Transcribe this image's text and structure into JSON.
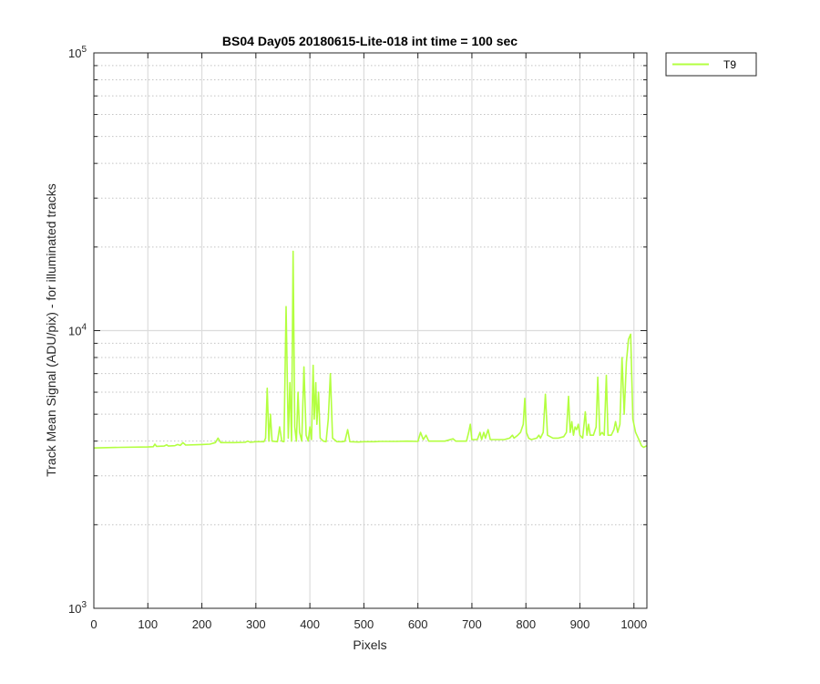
{
  "chart_data": {
    "type": "line",
    "title": "BS04 Day05 20180615-Lite-018 int time = 100 sec",
    "xlabel": "Pixels",
    "ylabel": "Track Mean Signal (ADU/pix) - for illuminated tracks",
    "xlim": [
      0,
      1024
    ],
    "ylim": [
      1000,
      100000
    ],
    "yscale": "log",
    "grid": true,
    "legend_position": "top-right outside",
    "x_ticks": [
      0,
      100,
      200,
      300,
      400,
      500,
      600,
      700,
      800,
      900,
      1000
    ],
    "x_tick_labels": [
      "0",
      "100",
      "200",
      "300",
      "400",
      "500",
      "600",
      "700",
      "800",
      "900",
      "1000"
    ],
    "y_ticks": [
      {
        "value": 1000,
        "base": "10",
        "exp": "3"
      },
      {
        "value": 10000,
        "base": "10",
        "exp": "4"
      },
      {
        "value": 100000,
        "base": "10",
        "exp": "5"
      }
    ],
    "series": [
      {
        "name": "T9",
        "color": "#b3ff40",
        "points": [
          [
            0,
            3780
          ],
          [
            50,
            3800
          ],
          [
            100,
            3810
          ],
          [
            110,
            3820
          ],
          [
            113,
            3900
          ],
          [
            116,
            3830
          ],
          [
            130,
            3840
          ],
          [
            135,
            3880
          ],
          [
            138,
            3840
          ],
          [
            150,
            3850
          ],
          [
            155,
            3890
          ],
          [
            160,
            3860
          ],
          [
            165,
            3950
          ],
          [
            170,
            3870
          ],
          [
            200,
            3890
          ],
          [
            215,
            3900
          ],
          [
            225,
            3950
          ],
          [
            230,
            4100
          ],
          [
            235,
            3950
          ],
          [
            260,
            3950
          ],
          [
            280,
            3960
          ],
          [
            285,
            4000
          ],
          [
            290,
            3960
          ],
          [
            300,
            3980
          ],
          [
            315,
            3980
          ],
          [
            318,
            4100
          ],
          [
            321,
            6200
          ],
          [
            324,
            4000
          ],
          [
            327,
            5000
          ],
          [
            330,
            4000
          ],
          [
            340,
            3980
          ],
          [
            344,
            4500
          ],
          [
            348,
            4000
          ],
          [
            352,
            3980
          ],
          [
            356,
            12200
          ],
          [
            360,
            4100
          ],
          [
            363,
            6500
          ],
          [
            366,
            4000
          ],
          [
            369,
            19300
          ],
          [
            372,
            4500
          ],
          [
            375,
            4000
          ],
          [
            378,
            6000
          ],
          [
            381,
            4300
          ],
          [
            385,
            4000
          ],
          [
            389,
            7400
          ],
          [
            393,
            4200
          ],
          [
            397,
            4000
          ],
          [
            400,
            4500
          ],
          [
            403,
            4050
          ],
          [
            406,
            7500
          ],
          [
            408,
            4800
          ],
          [
            411,
            6500
          ],
          [
            413,
            4600
          ],
          [
            416,
            6000
          ],
          [
            419,
            4100
          ],
          [
            425,
            4000
          ],
          [
            430,
            3980
          ],
          [
            434,
            4800
          ],
          [
            438,
            7000
          ],
          [
            442,
            4100
          ],
          [
            450,
            3980
          ],
          [
            460,
            3980
          ],
          [
            465,
            4000
          ],
          [
            470,
            4400
          ],
          [
            474,
            3980
          ],
          [
            490,
            3970
          ],
          [
            500,
            3980
          ],
          [
            520,
            3980
          ],
          [
            530,
            3990
          ],
          [
            560,
            3990
          ],
          [
            580,
            4000
          ],
          [
            600,
            3990
          ],
          [
            605,
            4300
          ],
          [
            610,
            4050
          ],
          [
            615,
            4200
          ],
          [
            620,
            4000
          ],
          [
            640,
            4000
          ],
          [
            650,
            4000
          ],
          [
            665,
            4080
          ],
          [
            670,
            4000
          ],
          [
            680,
            4000
          ],
          [
            690,
            4000
          ],
          [
            694,
            4300
          ],
          [
            697,
            4600
          ],
          [
            700,
            4050
          ],
          [
            710,
            4050
          ],
          [
            715,
            4300
          ],
          [
            718,
            4050
          ],
          [
            722,
            4300
          ],
          [
            725,
            4100
          ],
          [
            730,
            4400
          ],
          [
            734,
            4050
          ],
          [
            760,
            4050
          ],
          [
            770,
            4100
          ],
          [
            775,
            4200
          ],
          [
            778,
            4100
          ],
          [
            785,
            4200
          ],
          [
            790,
            4300
          ],
          [
            795,
            4600
          ],
          [
            798,
            5700
          ],
          [
            801,
            4300
          ],
          [
            805,
            4100
          ],
          [
            810,
            4050
          ],
          [
            820,
            4100
          ],
          [
            824,
            4200
          ],
          [
            827,
            4100
          ],
          [
            832,
            4300
          ],
          [
            836,
            5900
          ],
          [
            840,
            4200
          ],
          [
            850,
            4100
          ],
          [
            860,
            4100
          ],
          [
            870,
            4150
          ],
          [
            875,
            4300
          ],
          [
            879,
            5800
          ],
          [
            882,
            4300
          ],
          [
            885,
            4700
          ],
          [
            888,
            4200
          ],
          [
            891,
            4500
          ],
          [
            894,
            4400
          ],
          [
            897,
            4600
          ],
          [
            900,
            4200
          ],
          [
            905,
            4100
          ],
          [
            910,
            5100
          ],
          [
            913,
            4200
          ],
          [
            916,
            4600
          ],
          [
            919,
            4200
          ],
          [
            925,
            4200
          ],
          [
            930,
            4500
          ],
          [
            933,
            6800
          ],
          [
            937,
            4200
          ],
          [
            941,
            4300
          ],
          [
            945,
            4200
          ],
          [
            949,
            6900
          ],
          [
            952,
            4200
          ],
          [
            958,
            4200
          ],
          [
            963,
            4400
          ],
          [
            966,
            4700
          ],
          [
            970,
            4300
          ],
          [
            974,
            4600
          ],
          [
            978,
            8000
          ],
          [
            982,
            5000
          ],
          [
            986,
            7700
          ],
          [
            990,
            9300
          ],
          [
            994,
            9700
          ],
          [
            998,
            4800
          ],
          [
            1003,
            4300
          ],
          [
            1008,
            4100
          ],
          [
            1014,
            3850
          ],
          [
            1018,
            3800
          ],
          [
            1024,
            3850
          ]
        ]
      }
    ]
  }
}
